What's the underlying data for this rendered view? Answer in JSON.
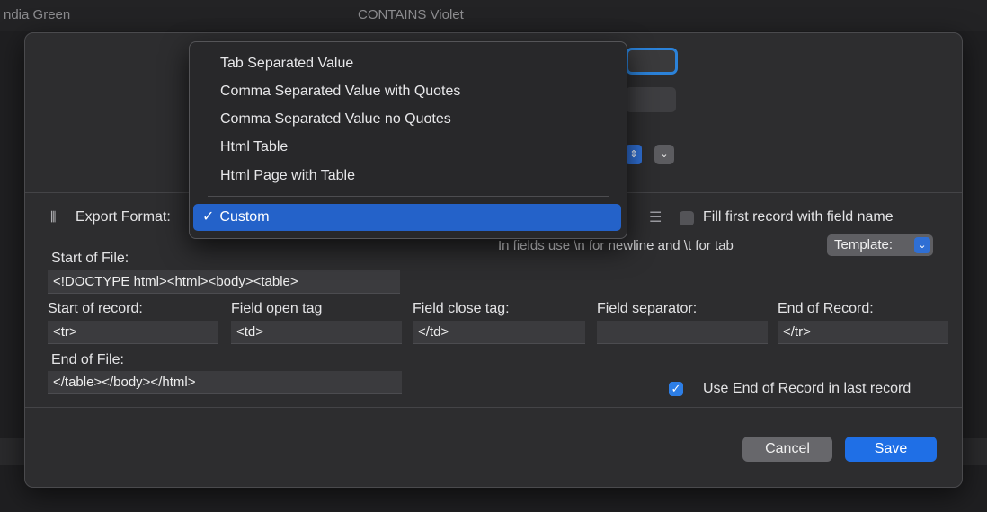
{
  "background": {
    "row_text_left": "ndia Green",
    "row_text_mid": "CONTAINS  Violet"
  },
  "dialog": {
    "export_format_label": "Export Format:",
    "fill_first_label": "Fill first record with field name",
    "fields_note": "In fields use \\n for newline and \\t for tab",
    "template_label": "Template:",
    "start_of_file_label": "Start of File:",
    "start_of_file_value": "<!DOCTYPE html><html><body><table>",
    "columns": [
      {
        "label": "Start of record:",
        "value": "<tr>"
      },
      {
        "label": "Field open tag",
        "value": "<td>"
      },
      {
        "label": "Field close tag:",
        "value": "</td>"
      },
      {
        "label": "Field separator:",
        "value": ""
      },
      {
        "label": "End of Record:",
        "value": "</tr>"
      }
    ],
    "end_of_file_label": "End of File:",
    "end_of_file_value": "</table></body></html>",
    "use_end_record_label": "Use End of Record in last record",
    "use_end_record_checked": true,
    "fill_first_checked": false,
    "cancel_label": "Cancel",
    "save_label": "Save"
  },
  "format_menu": {
    "items": [
      "Tab Separated Value",
      "Comma Separated Value with Quotes",
      "Comma Separated Value no Quotes",
      "Html Table",
      "Html Page with Table"
    ],
    "selected": "Custom",
    "check_glyph": "✓"
  },
  "colors": {
    "accent": "#2462c9",
    "save_button": "#1f6fe6",
    "focus_ring": "#2b82d9"
  }
}
